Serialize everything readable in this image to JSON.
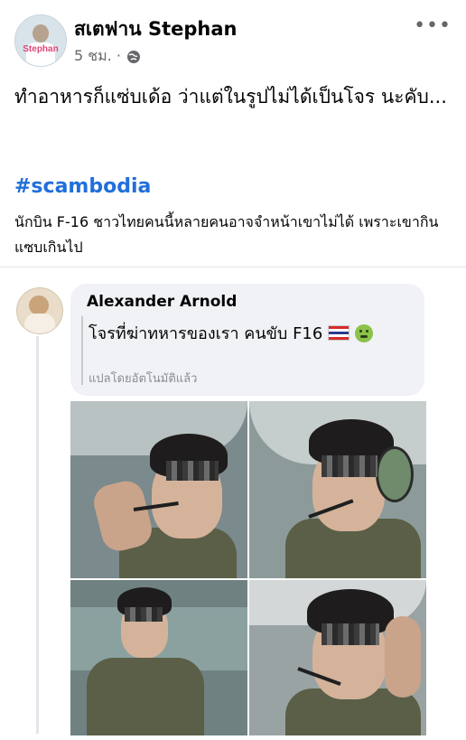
{
  "post": {
    "author": "สเตฟาน Stephan",
    "time": "5 ชม. ·",
    "avatar_brand": "Stephan",
    "more_icon": "•••",
    "text": "ทำอาหารก็แซ่บเด้อ ว่าแต่ในรูปไม่ได้เป็นโจร นะคับ...",
    "hashtag": "#scambodia",
    "caption": "นักบิน F-16 ชาวไทยคนนี้หลายคนอาจจำหน้าเขาไม่ได้ เพราะเขากินแซบเกินไป"
  },
  "comment": {
    "name": "Alexander Arnold",
    "text": "โจรที่ฆ่าทหารของเรา คนขับ F16",
    "translated_note": "แปลโดยอัตโนมัติแล้ว",
    "flag_colors": [
      "#d62b2b",
      "#ffffff",
      "#2b3a8f",
      "#ffffff",
      "#d62b2b"
    ]
  },
  "colors": {
    "link": "#216fdb",
    "muted": "#65676b",
    "bubble": "#f0f2f5"
  }
}
